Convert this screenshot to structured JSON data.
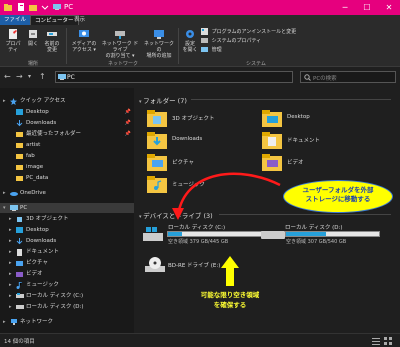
{
  "window": {
    "title": "PC",
    "minimize": "─",
    "maximize": "☐",
    "close": "✕",
    "accent": "#e6007e"
  },
  "ribbon_tabs": {
    "file": "ファイル",
    "computer": "コンピューター",
    "view": "表示"
  },
  "ribbon": {
    "properties": "プロパティ",
    "open": "開く",
    "rename_line1": "名前の",
    "rename_line2": "変更",
    "media_line1": "メディアの",
    "media_line2": "アクセス ▾",
    "map_line1": "ネットワーク ドライブ",
    "map_line2": "の割り当て ▾",
    "addloc_line1": "ネットワークの",
    "addloc_line2": "場所の追加",
    "settings_line1": "設定",
    "settings_line2": "を開く",
    "uninstall": "プログラムのアンインストールと変更",
    "sysprops": "システムのプロパティ",
    "manage": "管理",
    "group_location": "場所",
    "group_network": "ネットワーク",
    "group_system": "システム"
  },
  "address": {
    "back": "←",
    "forward": "→",
    "dropdown": "▾",
    "up": "↑",
    "path": "PC",
    "search_placeholder": "PCの検索"
  },
  "sidebar": {
    "quick_access": "クイック アクセス",
    "desktop": "Desktop",
    "downloads": "Downloads",
    "recent": "最近使ったフォルダー",
    "artist": "artist",
    "fab": "fab",
    "image": "image",
    "pc_data": "PC_data",
    "onedrive": "OneDrive",
    "pc": "PC",
    "objects3d": "3D オブジェクト",
    "desktop2": "Desktop",
    "downloads2": "Downloads",
    "documents": "ドキュメント",
    "pictures": "ピクチャ",
    "videos": "ビデオ",
    "music": "ミュージック",
    "local_c": "ローカル ディスク (C:)",
    "local_d": "ローカル ディスク (D:)",
    "network": "ネットワーク"
  },
  "folders_header": "フォルダー (7)",
  "folders": [
    "3D オブジェクト",
    "Desktop",
    "Downloads",
    "ドキュメント",
    "ピクチャ",
    "ビデオ",
    "ミュージック"
  ],
  "devices_header": "デバイスとドライブ (3)",
  "drives": {
    "c_name": "ローカル ディスク (C:)",
    "c_free": "空き領域 379 GB/445 GB",
    "c_used_fraction": 0.15,
    "d_name": "ローカル ディスク (D:)",
    "d_free": "空き領域 307 GB/540 GB",
    "d_used_fraction": 0.43,
    "bd_name": "BD-RE ドライブ (E:)"
  },
  "annotations": {
    "callout_1": "ユーザーフォルダを外部",
    "callout_2": "ストレージに移動する",
    "yellow_1": "可能な限り空き領域",
    "yellow_2": "を確保する"
  },
  "status": {
    "items": "14 個の項目"
  }
}
